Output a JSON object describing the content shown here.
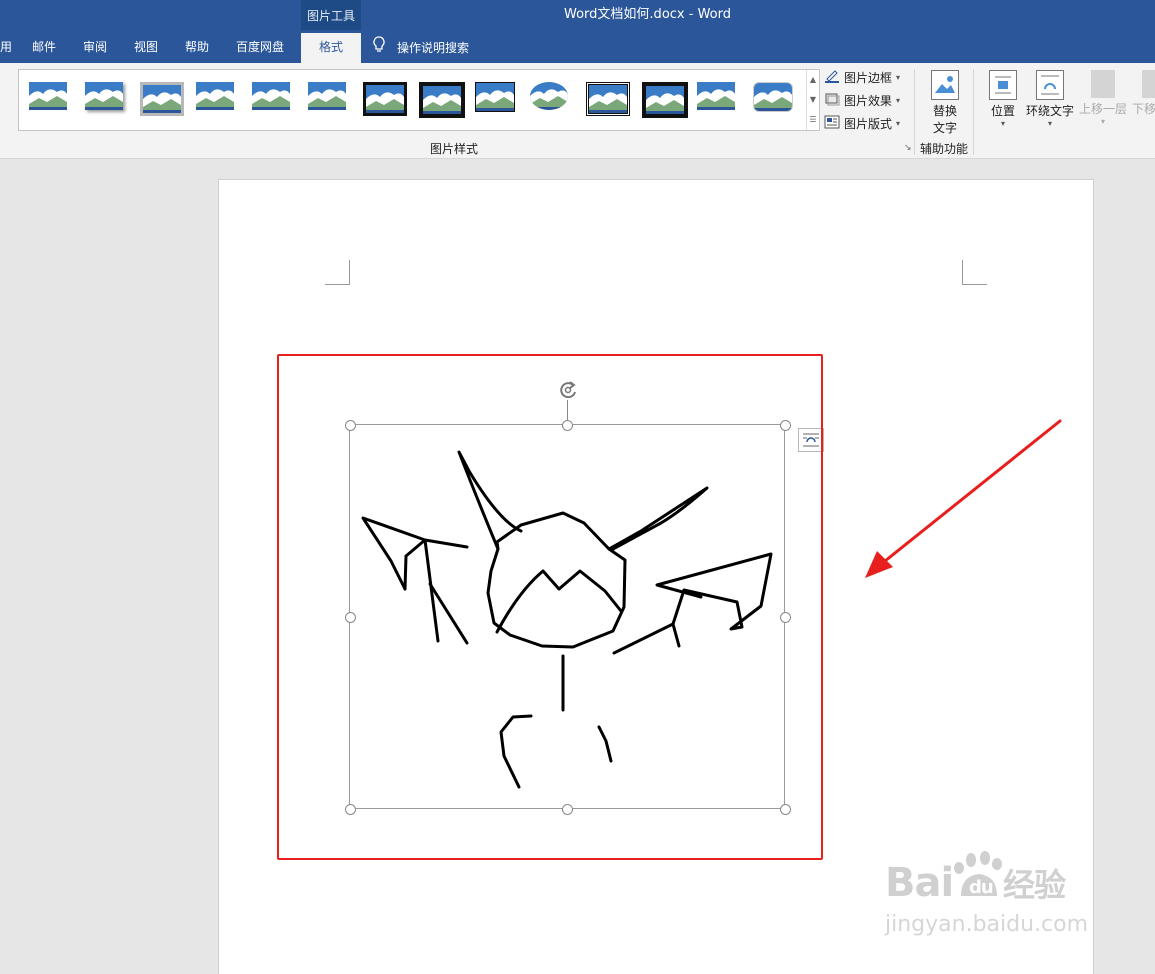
{
  "window": {
    "title": "Word文档如何.docx  -  Word",
    "context_tab_group": "图片工具"
  },
  "tabs": [
    {
      "label": "用",
      "active": false
    },
    {
      "label": "邮件",
      "active": false
    },
    {
      "label": "审阅",
      "active": false
    },
    {
      "label": "视图",
      "active": false
    },
    {
      "label": "帮助",
      "active": false
    },
    {
      "label": "百度网盘",
      "active": false
    },
    {
      "label": "格式",
      "active": true
    }
  ],
  "tell_me": {
    "label": "操作说明搜索",
    "icon": "lightbulb-icon"
  },
  "ribbon": {
    "picture_styles": {
      "group_label": "图片样式",
      "gallery_count": 14,
      "commands": [
        {
          "label": "图片边框",
          "icon": "pen-border-icon"
        },
        {
          "label": "图片效果",
          "icon": "effects-icon"
        },
        {
          "label": "图片版式",
          "icon": "layout-icon"
        }
      ]
    },
    "accessibility": {
      "group_label": "辅助功能",
      "alt_text_line1": "替换",
      "alt_text_line2": "文字"
    },
    "arrange": {
      "position": "位置",
      "wrap_text": "环绕文字",
      "bring_forward": "上移一层",
      "send_backward": "下移"
    }
  },
  "watermark": {
    "brand": "Bai du 经验",
    "url": "jingyan.baidu.com"
  }
}
